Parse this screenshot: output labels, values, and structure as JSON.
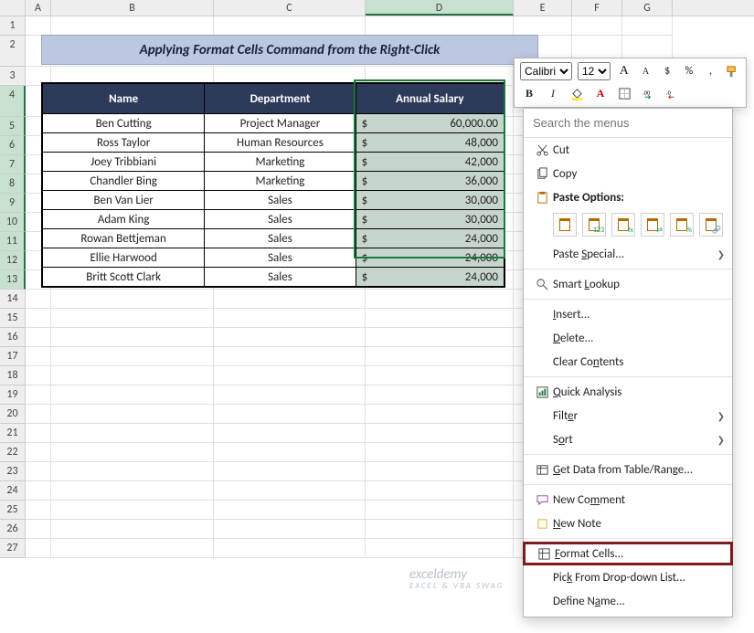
{
  "columns": [
    "A",
    "B",
    "C",
    "D",
    "E",
    "F",
    "G"
  ],
  "selected_col": "D",
  "rows": [
    1,
    2,
    3,
    4,
    5,
    6,
    7,
    8,
    9,
    10,
    11,
    12,
    13,
    14,
    15,
    16,
    17,
    18,
    19,
    20,
    21,
    22,
    23,
    24,
    25,
    26,
    27
  ],
  "selected_rows": [
    4,
    5,
    6,
    7,
    8,
    9,
    10,
    11,
    12,
    13
  ],
  "title": "Applying Format Cells Command from the Right-Click",
  "headers": {
    "name": "Name",
    "dept": "Department",
    "sal": "Annual Salary"
  },
  "records": [
    {
      "name": "Ben Cutting",
      "dept": "Project Manager",
      "cur": "$",
      "val": "60,000.00"
    },
    {
      "name": "Ross Taylor",
      "dept": "Human Resources",
      "cur": "$",
      "val": "48,000"
    },
    {
      "name": "Joey Tribbiani",
      "dept": "Marketing",
      "cur": "$",
      "val": "42,000"
    },
    {
      "name": "Chandler Bing",
      "dept": "Marketing",
      "cur": "$",
      "val": "36,000"
    },
    {
      "name": "Ben Van Lier",
      "dept": "Sales",
      "cur": "$",
      "val": "30,000"
    },
    {
      "name": "Adam King",
      "dept": "Sales",
      "cur": "$",
      "val": "30,000"
    },
    {
      "name": "Rowan Bettjeman",
      "dept": "Sales",
      "cur": "$",
      "val": "24,000"
    },
    {
      "name": "Ellie Harwood",
      "dept": "Sales",
      "cur": "$",
      "val": "24,000"
    },
    {
      "name": "Britt Scott Clark",
      "dept": "Sales",
      "cur": "$",
      "val": "24,000"
    }
  ],
  "mini": {
    "font": "Calibri",
    "size": "12",
    "incA": "A",
    "decA": "A",
    "bold": "B",
    "italic": "I",
    "currency": "$",
    "percent": "%",
    "comma": ","
  },
  "ctx": {
    "search_ph": "Search the menus",
    "cut": "Cut",
    "copy": "Copy",
    "paste_opts": "Paste Options:",
    "paste_special": "Paste Special...",
    "smart_lookup": "Smart Lookup",
    "insert": "Insert...",
    "delete": "Delete...",
    "clear": "Clear Contents",
    "quick": "Quick Analysis",
    "filter": "Filter",
    "sort": "Sort",
    "getdata": "Get Data from Table/Range...",
    "newcomment": "New Comment",
    "newnote": "New Note",
    "formatcells": "Format Cells...",
    "pick": "Pick From Drop-down List...",
    "defname": "Define Name..."
  },
  "watermark": {
    "main": "exceldemy",
    "sub": "EXCEL & VBA SWAG"
  },
  "colors": {
    "header_bg": "#2e3a5a",
    "banner_bg": "#bcc8e2",
    "sel_fill": "#c7d6cc",
    "sel_border": "#1a7a3e",
    "hl_border": "#7b1b1b"
  }
}
